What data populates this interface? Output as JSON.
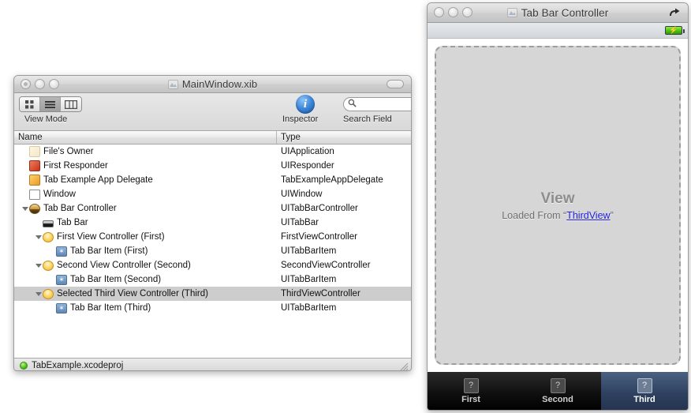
{
  "xib_window": {
    "title": "MainWindow.xib",
    "title_icon": "xib-document-icon",
    "toolbar": {
      "view_mode_label": "View Mode",
      "view_modes": [
        "icon-view",
        "list-view",
        "column-view"
      ],
      "view_mode_selected": "list-view",
      "inspector_label": "Inspector",
      "inspector_icon": "info-circle-icon",
      "search_label": "Search Field",
      "search_placeholder": "",
      "search_value": "",
      "search_icon": "magnifier-icon"
    },
    "columns": [
      "Name",
      "Type"
    ],
    "rows": [
      {
        "name": "File's Owner",
        "type": "UIApplication",
        "depth": 0,
        "icon": "cube-pale-icon",
        "expanded": null,
        "selected": false
      },
      {
        "name": "First Responder",
        "type": "UIResponder",
        "depth": 0,
        "icon": "cube-red-icon",
        "expanded": null,
        "selected": false
      },
      {
        "name": "Tab Example App Delegate",
        "type": "TabExampleAppDelegate",
        "depth": 0,
        "icon": "cube-orange-icon",
        "expanded": null,
        "selected": false
      },
      {
        "name": "Window",
        "type": "UIWindow",
        "depth": 0,
        "icon": "window-icon",
        "expanded": null,
        "selected": false
      },
      {
        "name": "Tab Bar Controller",
        "type": "UITabBarController",
        "depth": 0,
        "icon": "tabbarcontroller-icon",
        "expanded": true,
        "selected": false
      },
      {
        "name": "Tab Bar",
        "type": "UITabBar",
        "depth": 1,
        "icon": "tabbar-icon",
        "expanded": null,
        "selected": false
      },
      {
        "name": "First View Controller (First)",
        "type": "FirstViewController",
        "depth": 1,
        "icon": "viewcontroller-icon",
        "expanded": true,
        "selected": false
      },
      {
        "name": "Tab Bar Item (First)",
        "type": "UITabBarItem",
        "depth": 2,
        "icon": "tabbaritem-icon",
        "expanded": null,
        "selected": false
      },
      {
        "name": "Second View Controller (Second)",
        "type": "SecondViewController",
        "depth": 1,
        "icon": "viewcontroller-icon",
        "expanded": true,
        "selected": false
      },
      {
        "name": "Tab Bar Item (Second)",
        "type": "UITabBarItem",
        "depth": 2,
        "icon": "tabbaritem-icon",
        "expanded": null,
        "selected": false
      },
      {
        "name": "Selected Third View Controller (Third)",
        "type": "ThirdViewController",
        "depth": 1,
        "icon": "viewcontroller-icon",
        "expanded": true,
        "selected": true
      },
      {
        "name": "Tab Bar Item (Third)",
        "type": "UITabBarItem",
        "depth": 2,
        "icon": "tabbaritem-icon",
        "expanded": null,
        "selected": false
      }
    ],
    "status": {
      "project": "TabExample.xcodeproj",
      "project_icon": "green-orb-icon",
      "resize_grip": "resize-grip-icon"
    }
  },
  "sim_window": {
    "title": "Tab Bar Controller",
    "title_icon": "xib-document-icon",
    "rotate_icon": "rotate-arrow-icon",
    "status_bar": {
      "battery_icon": "battery-charging-icon"
    },
    "view": {
      "heading": "View",
      "subtext_prefix": "Loaded From “",
      "link": "ThirdView",
      "subtext_suffix": "”"
    },
    "tabs": [
      {
        "label": "First",
        "icon": "placeholder-item-icon",
        "active": false
      },
      {
        "label": "Second",
        "icon": "placeholder-item-icon",
        "active": false
      },
      {
        "label": "Third",
        "icon": "placeholder-item-icon",
        "active": true
      }
    ]
  },
  "colors": {
    "selection_gray": "#cdcdcd",
    "link_blue": "#1c1cdb",
    "tab_active_blue": "#2f4160",
    "battery_green": "#4fc413"
  }
}
